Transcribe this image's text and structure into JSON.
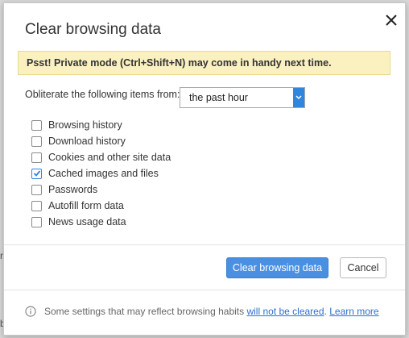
{
  "dialog": {
    "title": "Clear browsing data",
    "banner": "Psst! Private mode (Ctrl+Shift+N) may come in handy next time.",
    "from_label": "Obliterate the following items from:",
    "period_selected": "the past hour",
    "options": [
      {
        "label": "Browsing history",
        "checked": false
      },
      {
        "label": "Download history",
        "checked": false
      },
      {
        "label": "Cookies and other site data",
        "checked": false
      },
      {
        "label": "Cached images and files",
        "checked": true
      },
      {
        "label": "Passwords",
        "checked": false
      },
      {
        "label": "Autofill form data",
        "checked": false
      },
      {
        "label": "News usage data",
        "checked": false
      }
    ],
    "buttons": {
      "clear_label": "Clear browsing data",
      "cancel_label": "Cancel"
    },
    "footer": {
      "text": "Some settings that may reflect browsing habits",
      "link1": "will not be cleared",
      "sep": ".",
      "link2": "Learn more"
    }
  },
  "background": {
    "edge_letters": [
      "r",
      "b"
    ]
  },
  "colors": {
    "accent": "#4a90e2",
    "banner_bg": "#fbf1c0"
  },
  "icons": {
    "close": "close-icon",
    "dropdown": "chevron-down-icon",
    "info": "info-icon",
    "check": "check-icon"
  }
}
